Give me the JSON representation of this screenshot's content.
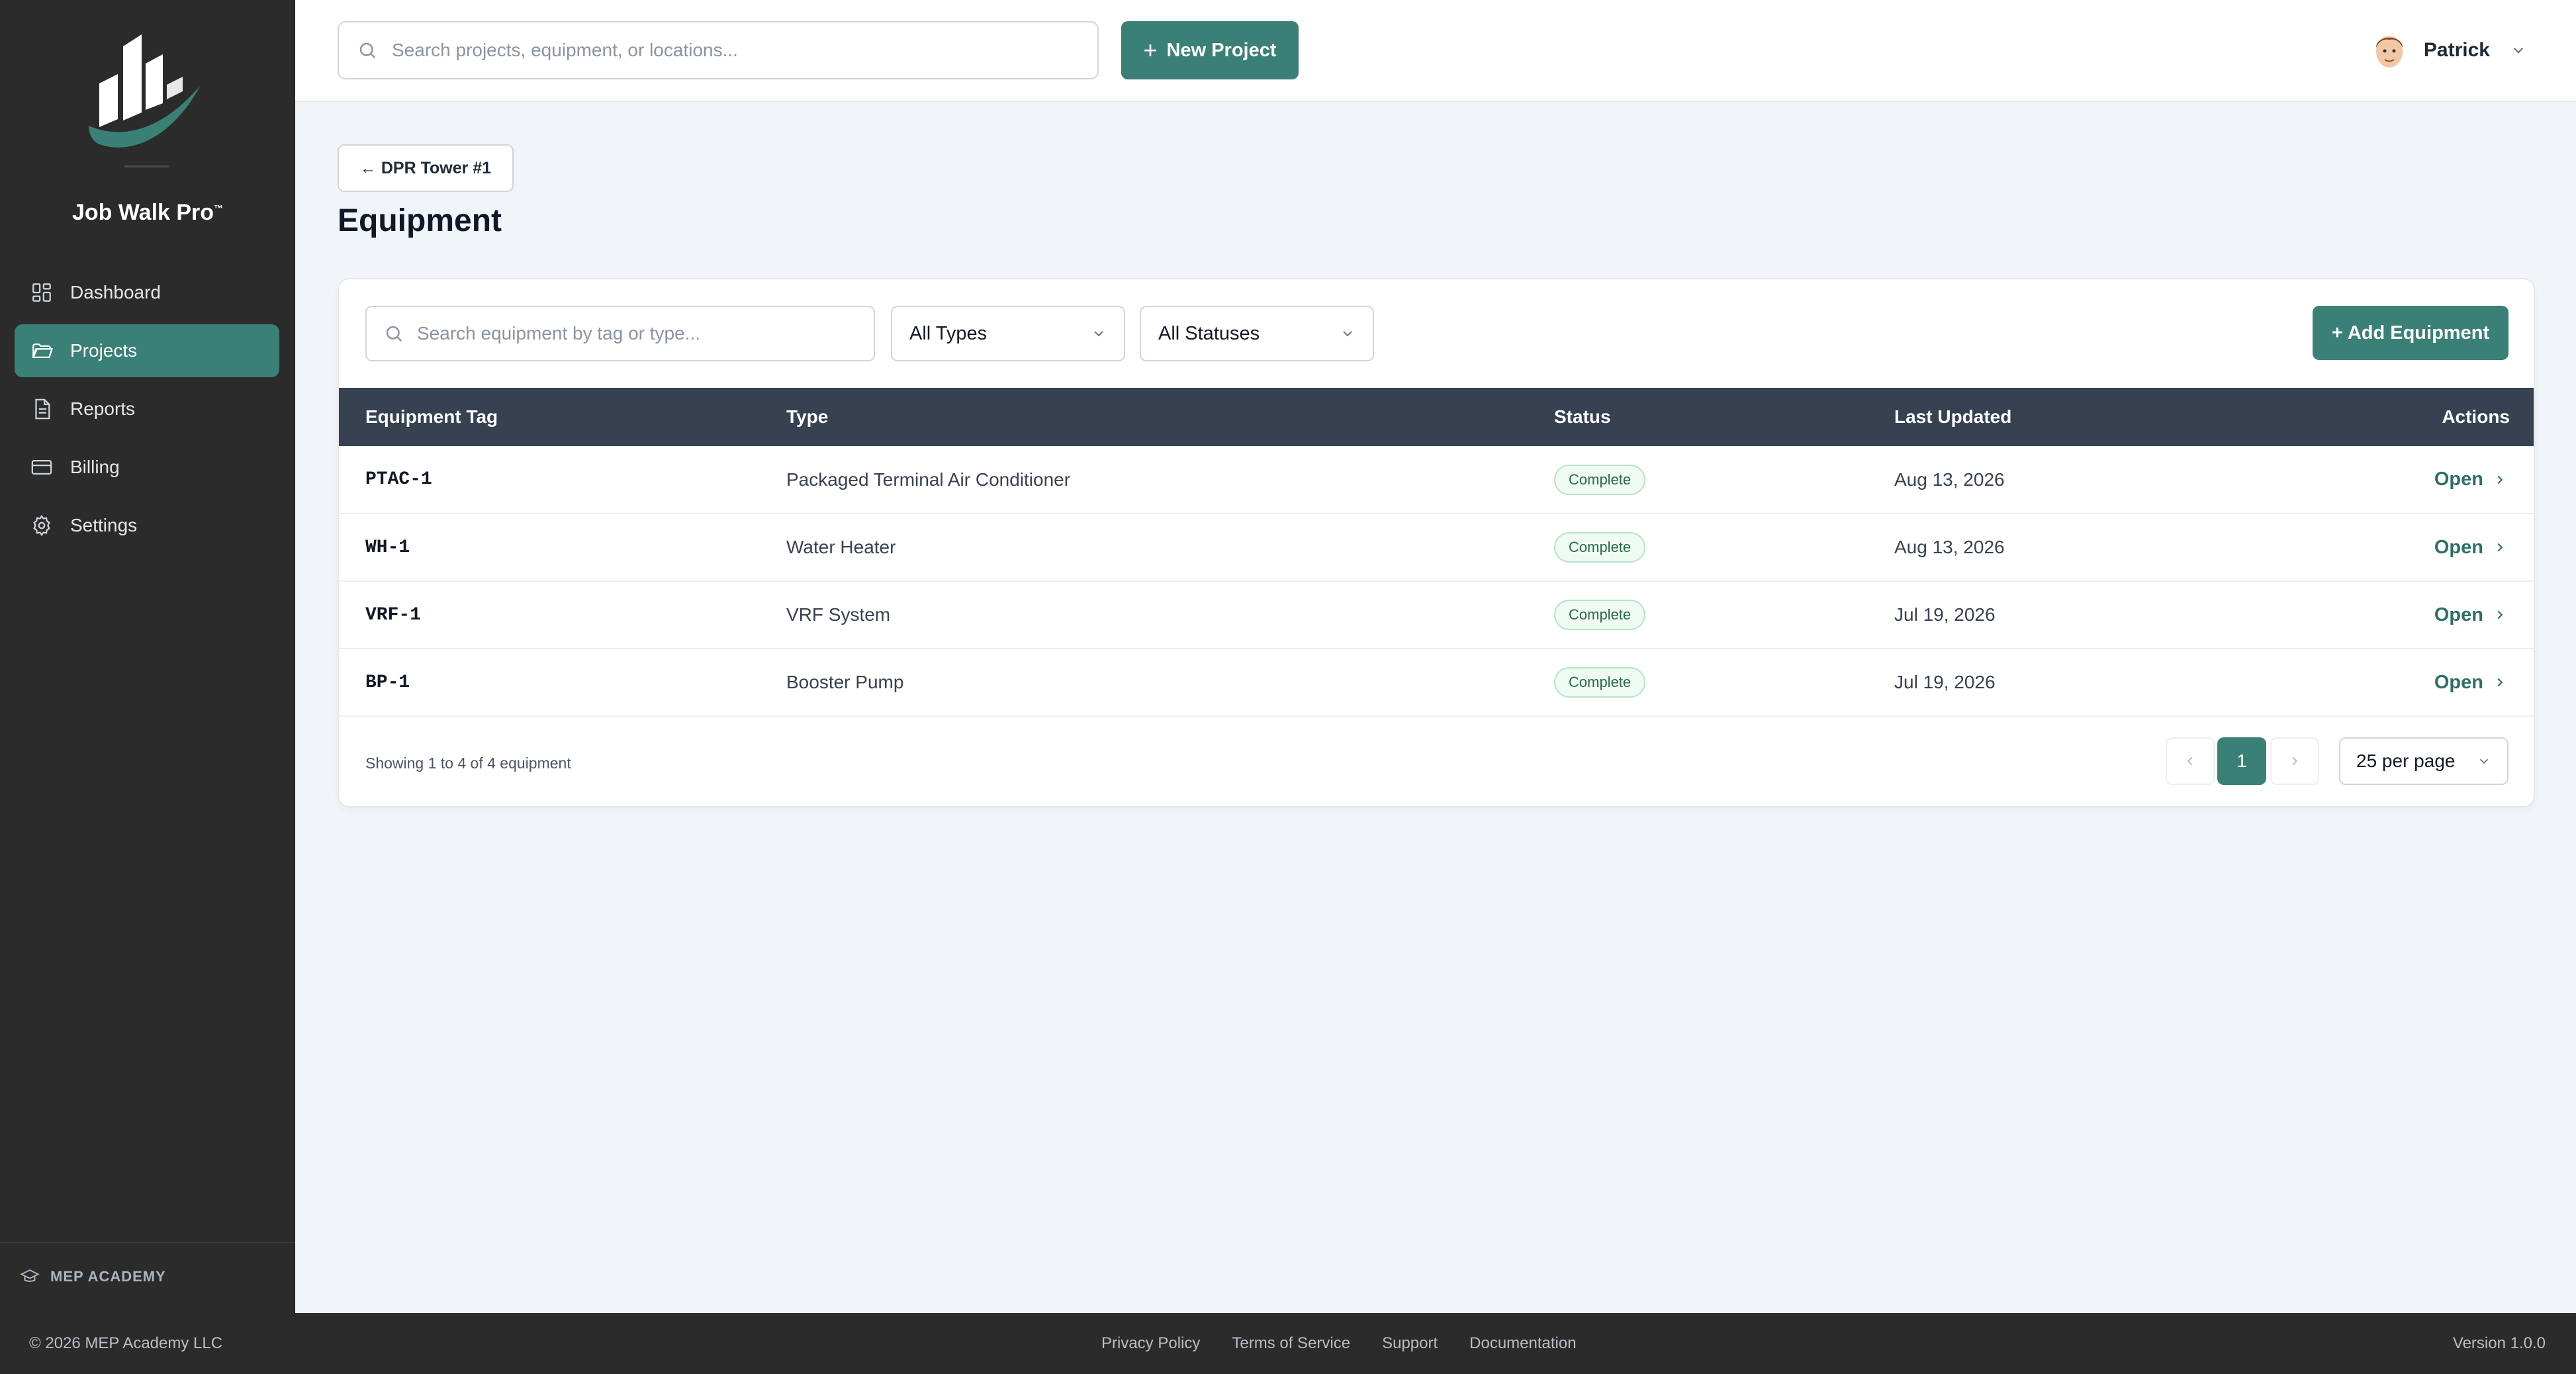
{
  "brand": {
    "name": "Job Walk Pro",
    "tm": "™"
  },
  "sidebar": {
    "items": [
      {
        "label": "Dashboard",
        "icon": "dashboard-icon"
      },
      {
        "label": "Projects",
        "icon": "folder-icon",
        "active": true
      },
      {
        "label": "Reports",
        "icon": "document-icon"
      },
      {
        "label": "Billing",
        "icon": "credit-card-icon"
      },
      {
        "label": "Settings",
        "icon": "gear-icon"
      }
    ],
    "academy_label": "MEP ACADEMY"
  },
  "header": {
    "search_placeholder": "Search projects, equipment, or locations...",
    "new_project_label": "New Project",
    "user_name": "Patrick"
  },
  "main": {
    "back_label": "← DPR Tower #1",
    "title": "Equipment",
    "search_placeholder": "Search equipment by tag or type...",
    "type_filter": "All Types",
    "status_filter": "All Statuses",
    "add_label": "+ Add Equipment",
    "columns": [
      "Equipment Tag",
      "Type",
      "Status",
      "Last Updated",
      "Actions"
    ],
    "rows": [
      {
        "tag": "PTAC-1",
        "type": "Packaged Terminal Air Conditioner",
        "status": "Complete",
        "updated": "Aug 13, 2026",
        "action": "Open"
      },
      {
        "tag": "WH-1",
        "type": "Water Heater",
        "status": "Complete",
        "updated": "Aug 13, 2026",
        "action": "Open"
      },
      {
        "tag": "VRF-1",
        "type": "VRF System",
        "status": "Complete",
        "updated": "Jul 19, 2026",
        "action": "Open"
      },
      {
        "tag": "BP-1",
        "type": "Booster Pump",
        "status": "Complete",
        "updated": "Jul 19, 2026",
        "action": "Open"
      }
    ],
    "showing": "Showing 1 to 4 of 4 equipment",
    "current_page": "1",
    "per_page": "25 per page"
  },
  "footer": {
    "copyright": "© 2026 MEP Academy LLC",
    "links": [
      "Privacy Policy",
      "Terms of Service",
      "Support",
      "Documentation"
    ],
    "version": "Version 1.0.0"
  },
  "colors": {
    "accent": "#3b8077",
    "sidebar_bg": "#2b2b2b",
    "table_header": "#374151",
    "status_complete": "#276c45"
  }
}
